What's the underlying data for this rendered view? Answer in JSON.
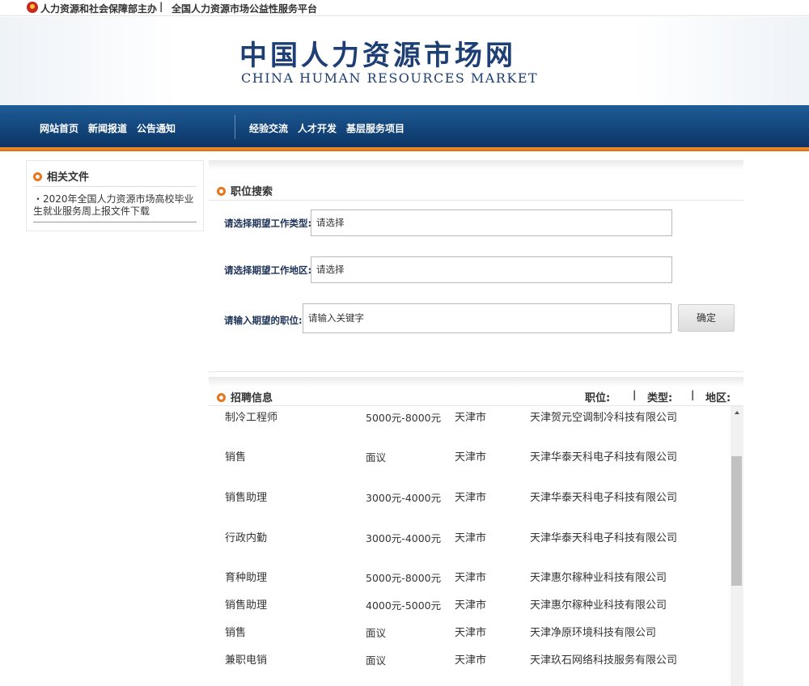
{
  "topbar": {
    "sponsor": "人力资源和社会保障部主办",
    "separator": "|",
    "platform": "全国人力资源市场公益性服务平台"
  },
  "header": {
    "logo_cn": "中国人力资源市场网",
    "logo_en": "CHINA HUMAN RESOURCES MARKET"
  },
  "nav": {
    "items": [
      {
        "label": "网站首页"
      },
      {
        "label": "新闻报道"
      },
      {
        "label": "公告通知"
      },
      {
        "label": "经验交流"
      },
      {
        "label": "人才开发"
      },
      {
        "label": "基层服务项目"
      }
    ]
  },
  "sidebar": {
    "title": "相关文件",
    "doc_link": "・2020年全国人力资源市场高校毕业生就业服务周上报文件下载"
  },
  "search": {
    "title": "职位搜索",
    "job_type_label": "请选择期望工作类型:",
    "job_type_value": "请选择",
    "region_label": "请选择期望工作地区:",
    "region_value": "请选择",
    "keyword_label": "请输入期望的职位:",
    "keyword_placeholder": "请输入关键字",
    "submit_label": "确定"
  },
  "jobs": {
    "title": "招聘信息",
    "filter_position": "职位:",
    "filter_type": "类型:",
    "filter_region": "地区:",
    "separator": "|",
    "rows": [
      {
        "title": "制冷工程师",
        "salary": "5000元-8000元",
        "city": "天津市",
        "company": "天津贺元空调制冷科技有限公司"
      },
      {
        "title": "销售",
        "salary": "面议",
        "city": "天津市",
        "company": "天津华泰天科电子科技有限公司"
      },
      {
        "title": "销售助理",
        "salary": "3000元-4000元",
        "city": "天津市",
        "company": "天津华泰天科电子科技有限公司"
      },
      {
        "title": "行政内勤",
        "salary": "3000元-4000元",
        "city": "天津市",
        "company": "天津华泰天科电子科技有限公司"
      },
      {
        "title": "育种助理",
        "salary": "5000元-8000元",
        "city": "天津市",
        "company": "天津惠尔稼种业科技有限公司"
      },
      {
        "title": "销售助理",
        "salary": "4000元-5000元",
        "city": "天津市",
        "company": "天津惠尔稼种业科技有限公司"
      },
      {
        "title": "销售",
        "salary": "面议",
        "city": "天津市",
        "company": "天津净原环境科技有限公司"
      },
      {
        "title": "兼职电销",
        "salary": "面议",
        "city": "天津市",
        "company": "天津玖石网络科技服务有限公司"
      }
    ]
  }
}
